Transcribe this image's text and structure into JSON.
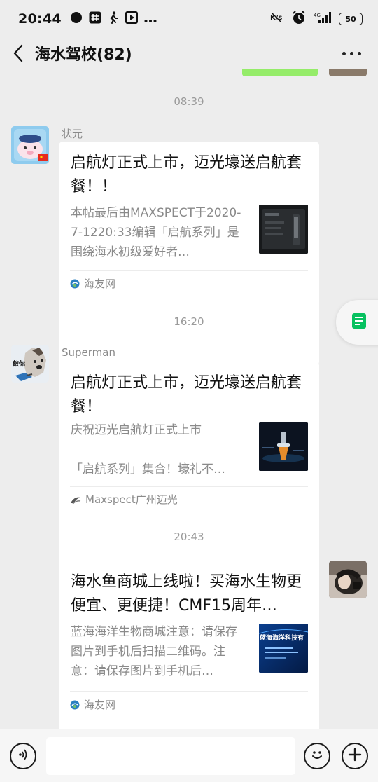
{
  "status_bar": {
    "time": "20:44",
    "battery": "50",
    "icons": [
      "notification-dot-icon",
      "hashtag-app-icon",
      "running-icon",
      "media-play-icon",
      "more-dots-icon",
      "mute-network-icon",
      "alarm-icon",
      "signal-icon",
      "battery-icon"
    ]
  },
  "nav": {
    "title": "海水驾校(82)",
    "back_icon": "chevron-left-icon",
    "more_icon": "more-dots-icon"
  },
  "messages": [
    {
      "timestamp": "08:39",
      "sender": "状元",
      "card": {
        "title": "启航灯正式上市，迈光壕送启航套餐！！",
        "description": "本帖最后由MAXSPECT于2020-7-1220:33编辑「启航系列」是围绕海水初级爱好者…",
        "source": "海友网"
      }
    },
    {
      "timestamp": "16:20",
      "sender": "Superman",
      "avatar_caption": "敲你",
      "card": {
        "title": "启航灯正式上市，迈光壕送启航套餐！",
        "description_lines": [
          "庆祝迈光启航灯正式上市",
          "",
          "「启航系列」集合！壕礼不…"
        ],
        "source": "Maxspect广州迈光"
      }
    },
    {
      "timestamp": "20:43",
      "sender": "me",
      "card": {
        "title": "海水鱼商城上线啦！买海水生物更便宜、更便捷！CMF15周年…",
        "description": "蓝海海洋生物商城注意：请保存图片到手机后扫描二维码。注意：请保存图片到手机后…",
        "thumb_caption": "蓝海海洋科技有",
        "source": "海友网"
      }
    }
  ],
  "input_bar": {
    "placeholder": "",
    "voice_icon": "voice-icon",
    "emoji_icon": "emoji-icon",
    "plus_icon": "plus-icon"
  },
  "colors": {
    "background": "#ededed",
    "card": "#ffffff",
    "float_note_icon": "#07c160",
    "outgoing_bubble": "#95ec69"
  }
}
